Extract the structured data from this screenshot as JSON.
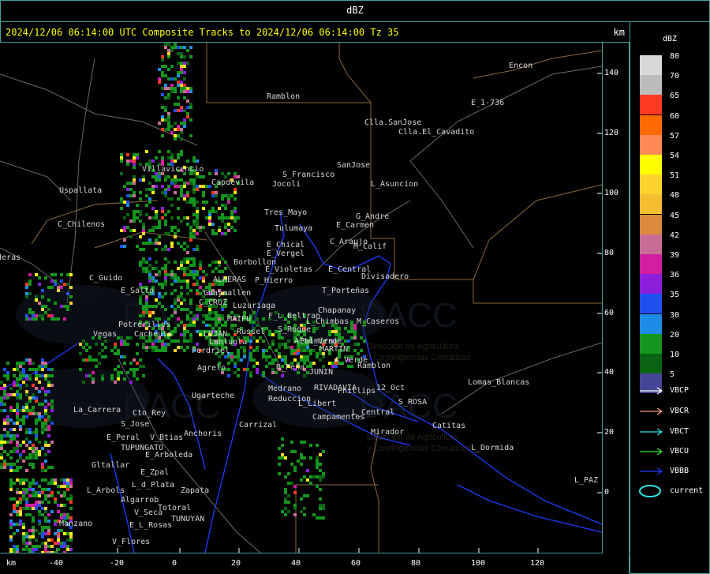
{
  "header": {
    "product": "dBZ"
  },
  "title_bar": {
    "text": "2024/12/06 06:14:00 UTC Composite Tracks to 2024/12/06 06:14:00 Tz 35",
    "unit": "km"
  },
  "axes": {
    "x_unit": "km",
    "x_ticks": [
      "-40",
      "-20",
      "0",
      "20",
      "40",
      "60",
      "80",
      "100",
      "120"
    ],
    "y_ticks": [
      "140",
      "120",
      "100",
      "80",
      "60",
      "40",
      "20",
      "0"
    ]
  },
  "watermark": {
    "logo_text": "DACC",
    "subtitle_1": "Dirección de Agricultura",
    "subtitle_2": "y Contingencias Climáticas"
  },
  "places": [
    {
      "name": "Ramblon"
    },
    {
      "name": "Clla.SanJose"
    },
    {
      "name": "Clla.El_Cavadito"
    },
    {
      "name": "Encon"
    },
    {
      "name": "E_1-736"
    },
    {
      "name": "S_Francisco"
    },
    {
      "name": "Jocoli"
    },
    {
      "name": "SanJose"
    },
    {
      "name": "L_Asuncion"
    },
    {
      "name": "Uspallata"
    },
    {
      "name": "Villavicencio"
    },
    {
      "name": "Capdevila"
    },
    {
      "name": "Tres_Mayo"
    },
    {
      "name": "Tulumaya"
    },
    {
      "name": "G_Andre"
    },
    {
      "name": "E_Carmen"
    },
    {
      "name": "C_Chilenos"
    },
    {
      "name": "E_Chical"
    },
    {
      "name": "E_Vergel"
    },
    {
      "name": "C_Araujo"
    },
    {
      "name": "M_Calif"
    },
    {
      "name": "Borbollon"
    },
    {
      "name": "E_Violetas"
    },
    {
      "name": "E_Central"
    },
    {
      "name": "Divisadero"
    },
    {
      "name": "C_Guido"
    },
    {
      "name": "ALHERAS"
    },
    {
      "name": "P_Hierro"
    },
    {
      "name": "E_Salto"
    },
    {
      "name": "T_Porteñas"
    },
    {
      "name": "C_CRUZ"
    },
    {
      "name": "Guaymallen"
    },
    {
      "name": "Chapanay"
    },
    {
      "name": "Luzuriaga"
    },
    {
      "name": "F_L_Beltran"
    },
    {
      "name": "MAIPU"
    },
    {
      "name": "Potrerillos"
    },
    {
      "name": "Cacheuta"
    },
    {
      "name": "Vegas"
    },
    {
      "name": "Russel"
    },
    {
      "name": "L_Chimbas"
    },
    {
      "name": "M_Caseros"
    },
    {
      "name": "LUJAN"
    },
    {
      "name": "Lunlunta"
    },
    {
      "name": "S_Roque"
    },
    {
      "name": "Perdriel"
    },
    {
      "name": "Alto_Verde"
    },
    {
      "name": "MARTIN"
    },
    {
      "name": "Agrelo"
    },
    {
      "name": "Palmira"
    },
    {
      "name": "A_Verde"
    },
    {
      "name": "Ramblon"
    },
    {
      "name": "R_Peña"
    },
    {
      "name": "JUNIN"
    },
    {
      "name": "Lomas_Blancas"
    },
    {
      "name": "12_Oct"
    },
    {
      "name": "Ugarteche"
    },
    {
      "name": "Medrano"
    },
    {
      "name": "RIVADAVIA"
    },
    {
      "name": "Phillips"
    },
    {
      "name": "Reduccion"
    },
    {
      "name": "S_ROSA"
    },
    {
      "name": "La_Carrera"
    },
    {
      "name": "L_Libert"
    },
    {
      "name": "Cto_Rey"
    },
    {
      "name": "Campamentos"
    },
    {
      "name": "L_Central"
    },
    {
      "name": "S_Jose"
    },
    {
      "name": "Carrizal"
    },
    {
      "name": "Catitas"
    },
    {
      "name": "E_Peral"
    },
    {
      "name": "V_Btias"
    },
    {
      "name": "Anchoris"
    },
    {
      "name": "Mirador"
    },
    {
      "name": "TUPUNGATO"
    },
    {
      "name": "E_Arboleda"
    },
    {
      "name": "L_Dormida"
    },
    {
      "name": "Gltallar"
    },
    {
      "name": "E_Zpal"
    },
    {
      "name": "L_d_Plata"
    },
    {
      "name": "Zapata"
    },
    {
      "name": "L_PAZ"
    },
    {
      "name": "L_Arbols"
    },
    {
      "name": "Algarrob"
    },
    {
      "name": "V_Seca"
    },
    {
      "name": "Totoral"
    },
    {
      "name": "Manzano"
    },
    {
      "name": "E_L_Rosas"
    },
    {
      "name": "TUNUYAN"
    },
    {
      "name": "V_Flores"
    },
    {
      "name": "aderas"
    }
  ],
  "legend": {
    "title": "dBZ",
    "scale": [
      {
        "label": "80",
        "color": "#d8d8d8"
      },
      {
        "label": "70",
        "color": "#bcbcbc"
      },
      {
        "label": "65",
        "color": "#ff3a22"
      },
      {
        "label": "60",
        "color": "#ff6a00"
      },
      {
        "label": "57",
        "color": "#ff8a55"
      },
      {
        "label": "54",
        "color": "#ffff00"
      },
      {
        "label": "51",
        "color": "#ffd22e"
      },
      {
        "label": "48",
        "color": "#f5be30"
      },
      {
        "label": "45",
        "color": "#dc8a3c"
      },
      {
        "label": "42",
        "color": "#c86e96"
      },
      {
        "label": "39",
        "color": "#d21ea0"
      },
      {
        "label": "36",
        "color": "#8c1edc"
      },
      {
        "label": "35",
        "color": "#1e50f0"
      },
      {
        "label": "30",
        "color": "#1e8ce6"
      },
      {
        "label": "20",
        "color": "#14961e"
      },
      {
        "label": "10",
        "color": "#0a6414"
      },
      {
        "label": "5",
        "color": "#464696"
      }
    ],
    "tracks": [
      {
        "label": "VBCP",
        "color": "#ffffff"
      },
      {
        "label": "VBCR",
        "color": "#f5a07a"
      },
      {
        "label": "VBCT",
        "color": "#2ee6e6"
      },
      {
        "label": "VBCU",
        "color": "#2ee62e"
      },
      {
        "label": "VBBB",
        "color": "#1e3cff"
      },
      {
        "label": "current",
        "color": "#2ee6e6"
      }
    ]
  }
}
